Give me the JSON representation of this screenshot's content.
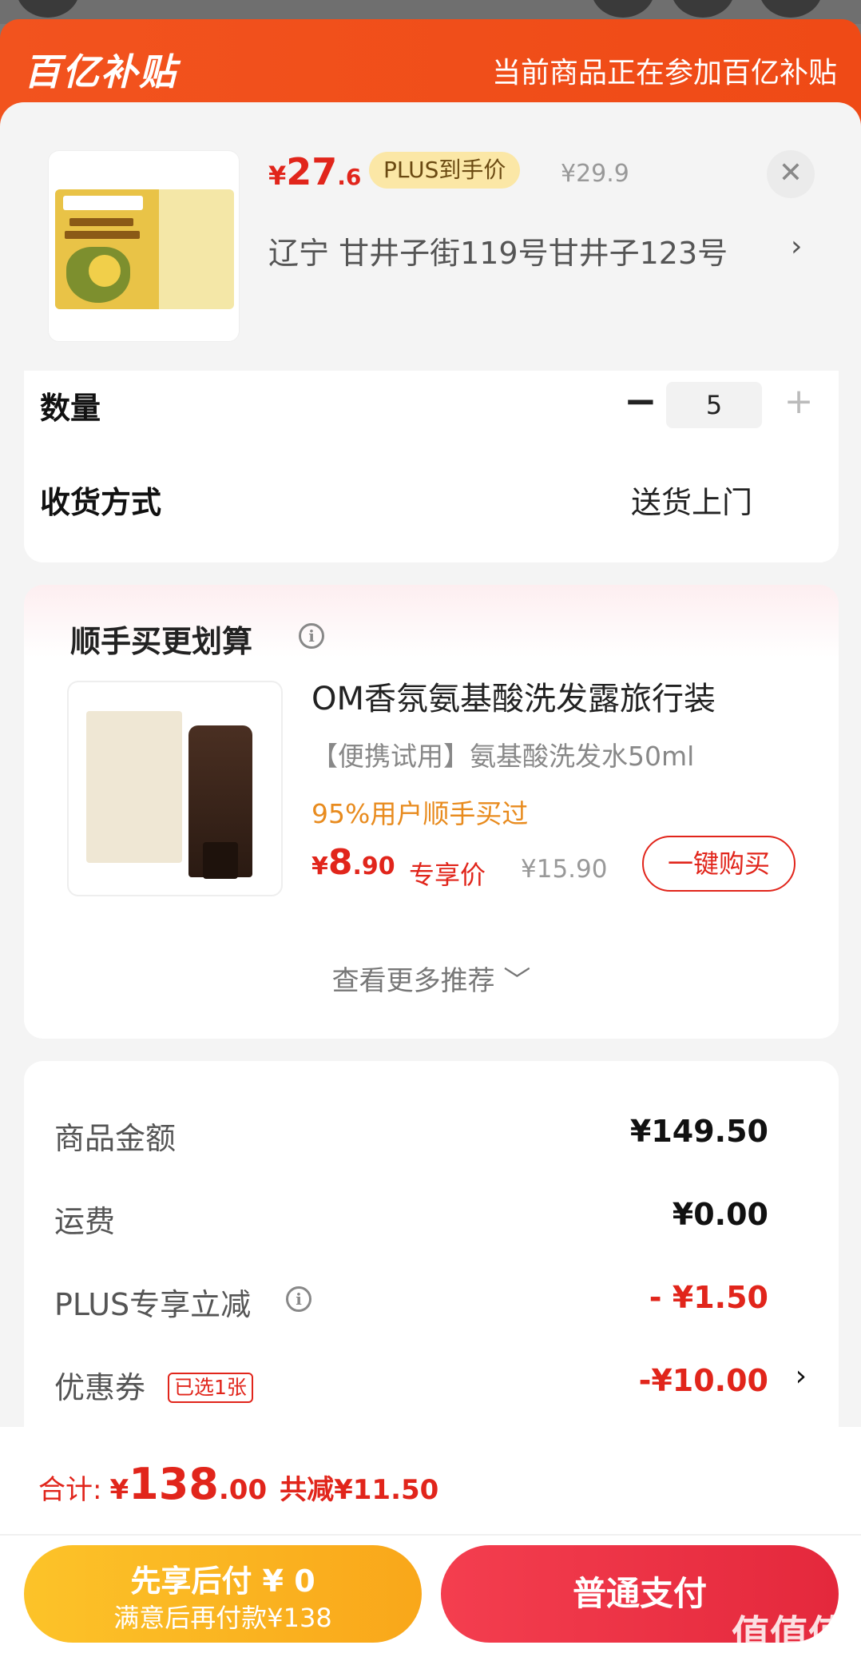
{
  "banner": {
    "logo": "百亿补贴",
    "notice": "当前商品正在参加百亿补贴"
  },
  "product": {
    "price_currency": "¥",
    "price_int": "27",
    "price_dec": ".6",
    "plus_tag": "PLUS到手价",
    "original_price": "¥29.9",
    "close_icon": "close-icon",
    "address": "辽宁  甘井子街119号甘井子123号",
    "address_arrow": "›"
  },
  "options": {
    "quantity_label": "数量",
    "quantity_minus": "−",
    "quantity_value": "5",
    "quantity_plus": "+",
    "delivery_label": "收货方式",
    "delivery_value": "送货上门"
  },
  "recommend": {
    "title": "顺手买更划算",
    "info_icon": "i",
    "item_name": "OM香氛氨基酸洗发露旅行装",
    "item_sub": "【便携试用】氨基酸洗发水50ml",
    "item_rate": "95%用户顺手买过",
    "price_currency": "¥",
    "price_int": "8",
    "price_dec": ".90",
    "exclusive_label": "专享价",
    "original_price": "¥15.90",
    "buy_button": "一键购买",
    "more_link": "查看更多推荐 ﹀"
  },
  "summary": {
    "rows": [
      {
        "label": "商品金额",
        "value": "¥149.50"
      },
      {
        "label": "运费",
        "value": "¥0.00"
      },
      {
        "label": "PLUS专享立减",
        "value": "- ¥1.50"
      },
      {
        "label": "优惠券",
        "value": "-¥10.00"
      }
    ],
    "info_icon": "i",
    "coupon_tag": "已选1张",
    "coupon_arrow": "›"
  },
  "footer": {
    "total_label": "合计:",
    "total_currency": "¥",
    "total_int": "138",
    "total_dec": ".00",
    "total_saved": "共减¥11.50",
    "pay_later_line1": "先享后付 ¥ 0",
    "pay_later_line2": "满意后再付款¥138",
    "pay_button": "普通支付",
    "watermark": "值值值",
    "watermark_url": "zhizhizhi.com"
  },
  "colors": {
    "brand_red": "#e1251b",
    "banner_orange": "#f2531e",
    "pay_later_yellow": "#fcc329",
    "pay_red": "#f43e4f"
  }
}
